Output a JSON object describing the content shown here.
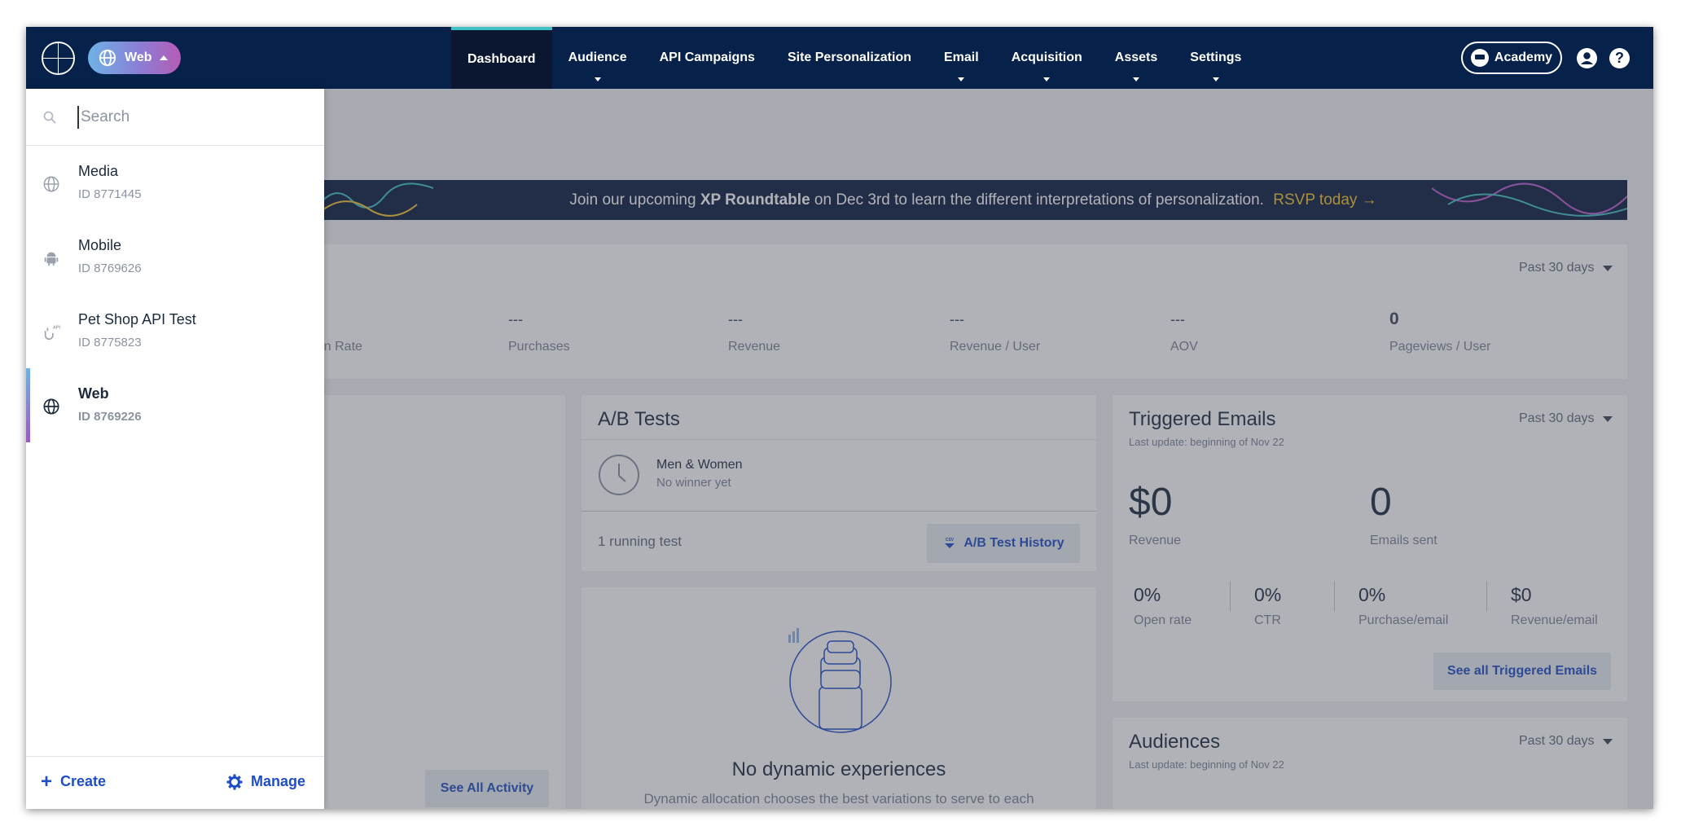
{
  "nav": {
    "site_selector": "Web",
    "items": [
      {
        "label": "Dashboard",
        "active": true,
        "dropdown": false
      },
      {
        "label": "Audience",
        "active": false,
        "dropdown": true
      },
      {
        "label": "API Campaigns",
        "active": false,
        "dropdown": false
      },
      {
        "label": "Site Personalization",
        "active": false,
        "dropdown": false
      },
      {
        "label": "Email",
        "active": false,
        "dropdown": true
      },
      {
        "label": "Acquisition",
        "active": false,
        "dropdown": true
      },
      {
        "label": "Assets",
        "active": false,
        "dropdown": true
      },
      {
        "label": "Settings",
        "active": false,
        "dropdown": true
      }
    ],
    "academy": "Academy",
    "help": "?"
  },
  "colors": {
    "navbar": "#06214a",
    "active_tab_accent": "#3fc0c6",
    "link_blue": "#1f4dc4",
    "rsvp": "#f4c430"
  },
  "site_panel": {
    "search_placeholder": "Search",
    "sites": [
      {
        "name": "Media",
        "id": "ID 8771445",
        "icon": "globe-icon",
        "selected": false
      },
      {
        "name": "Mobile",
        "id": "ID 8769626",
        "icon": "android-icon",
        "selected": false
      },
      {
        "name": "Pet Shop API Test",
        "id": "ID 8775823",
        "icon": "api-icon",
        "selected": false
      },
      {
        "name": "Web",
        "id": "ID 8769226",
        "icon": "globe-icon",
        "selected": true
      }
    ],
    "create": "Create",
    "manage": "Manage"
  },
  "banner": {
    "pre": "Join our upcoming",
    "bold": "XP Roundtable",
    "post": "on Dec 3rd to learn the different interpretations of personalization.",
    "link": "RSVP today →"
  },
  "kpis": {
    "period": "Past 30 days",
    "items": [
      {
        "value": "",
        "label": "rsion Rate"
      },
      {
        "value": "---",
        "label": "Purchases"
      },
      {
        "value": "---",
        "label": "Revenue"
      },
      {
        "value": "---",
        "label": "Revenue / User"
      },
      {
        "value": "---",
        "label": "AOV"
      },
      {
        "value": "0",
        "label": "Pageviews / User"
      }
    ]
  },
  "activity": {
    "see_all": "See All Activity"
  },
  "ab_tests": {
    "title": "A/B Tests",
    "test_name": "Men & Women",
    "test_status": "No winner yet",
    "running": "1 running test",
    "history_button": "A/B Test History",
    "history_icon_text": "CSV"
  },
  "dynamic": {
    "title": "No dynamic experiences",
    "text": "Dynamic allocation chooses the best variations to serve to each"
  },
  "triggered": {
    "title": "Triggered Emails",
    "period": "Past 30 days",
    "update": "Last update: beginning of Nov 22",
    "revenue_value": "$0",
    "revenue_label": "Revenue",
    "sent_value": "0",
    "sent_label": "Emails sent",
    "metrics": [
      {
        "value": "0%",
        "label": "Open rate"
      },
      {
        "value": "0%",
        "label": "CTR"
      },
      {
        "value": "0%",
        "label": "Purchase/email"
      },
      {
        "value": "$0",
        "label": "Revenue/email"
      }
    ],
    "see_all": "See all Triggered Emails"
  },
  "audiences": {
    "title": "Audiences",
    "period": "Past 30 days",
    "update": "Last update: beginning of Nov 22"
  }
}
